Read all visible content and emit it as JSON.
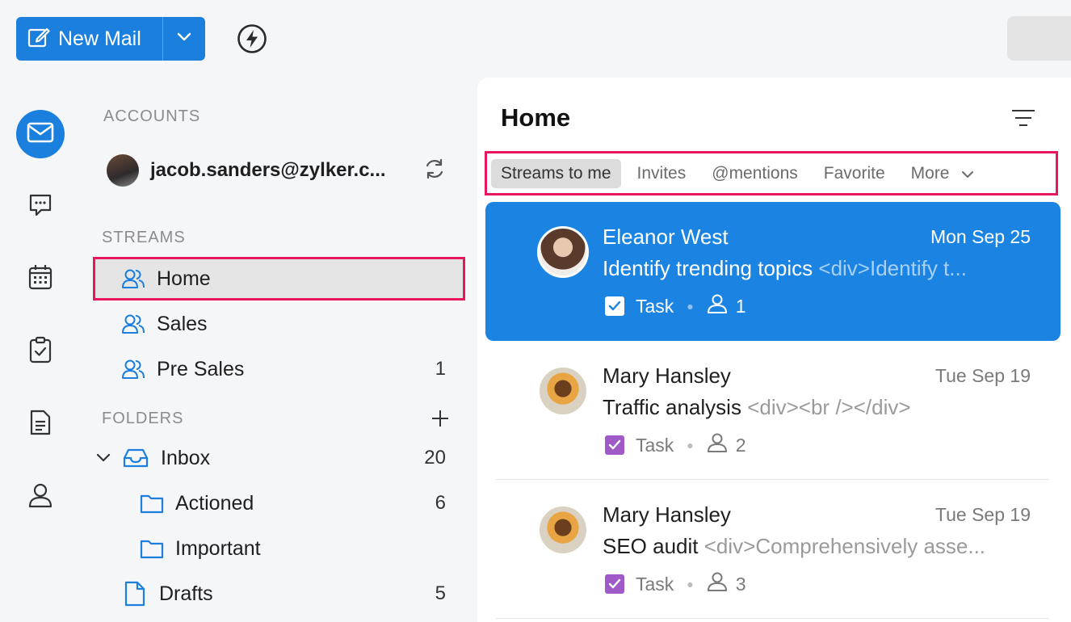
{
  "toolbar": {
    "new_mail_label": "New Mail"
  },
  "sidebar": {
    "accounts_title": "ACCOUNTS",
    "account_email": "jacob.sanders@zylker.c...",
    "streams_title": "STREAMS",
    "streams": [
      {
        "label": "Home",
        "count": ""
      },
      {
        "label": "Sales",
        "count": ""
      },
      {
        "label": "Pre Sales",
        "count": "1"
      }
    ],
    "folders_title": "FOLDERS",
    "folders": [
      {
        "label": "Inbox",
        "count": "20"
      },
      {
        "label": "Actioned",
        "count": "6"
      },
      {
        "label": "Important",
        "count": ""
      },
      {
        "label": "Drafts",
        "count": "5"
      }
    ]
  },
  "main": {
    "title": "Home",
    "tabs": [
      {
        "label": "Streams to me"
      },
      {
        "label": "Invites"
      },
      {
        "label": "@mentions"
      },
      {
        "label": "Favorite"
      },
      {
        "label": "More"
      }
    ],
    "messages": [
      {
        "from": "Eleanor West",
        "date": "Mon Sep 25",
        "subject": "Identify trending topics",
        "preview": "<div>Identify t...",
        "type": "Task",
        "count": "1"
      },
      {
        "from": "Mary Hansley",
        "date": "Tue Sep 19",
        "subject": "Traffic analysis",
        "preview": "<div><br /></div>",
        "type": "Task",
        "count": "2"
      },
      {
        "from": "Mary Hansley",
        "date": "Tue Sep 19",
        "subject": "SEO audit",
        "preview": "<div>Comprehensively asse...",
        "type": "Task",
        "count": "3"
      }
    ]
  },
  "colors": {
    "accent": "#1b7fde",
    "highlight": "#e8175d",
    "task_purple": "#a05ac8"
  }
}
